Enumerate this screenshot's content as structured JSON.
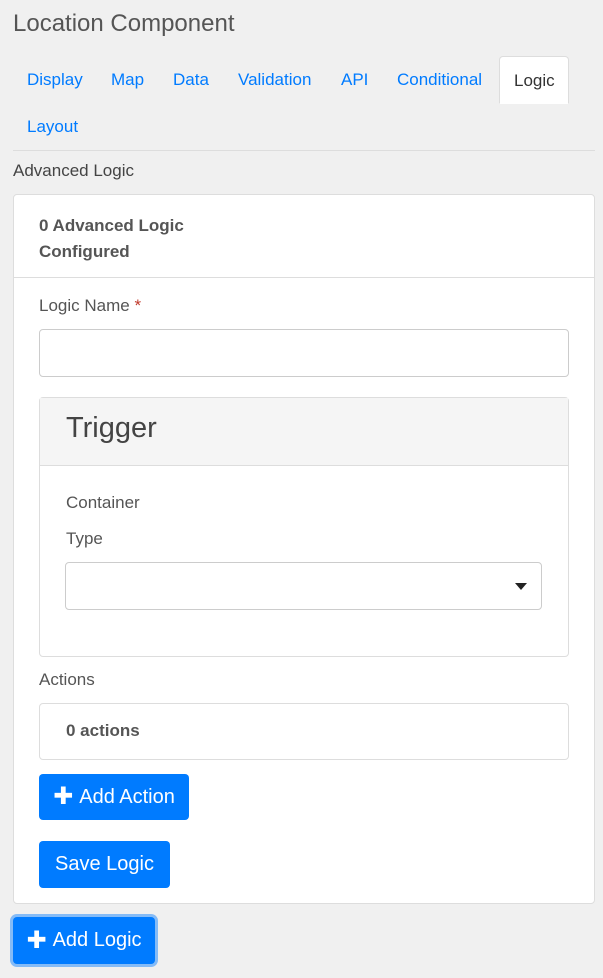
{
  "title": "Location Component",
  "tabs": [
    {
      "label": "Display"
    },
    {
      "label": "Map"
    },
    {
      "label": "Data"
    },
    {
      "label": "Validation"
    },
    {
      "label": "API"
    },
    {
      "label": "Conditional"
    },
    {
      "label": "Logic"
    },
    {
      "label": "Layout"
    }
  ],
  "active_tab": "Logic",
  "section_label": "Advanced Logic",
  "card": {
    "header_line1": "0 Advanced Logic",
    "header_line2": "Configured",
    "logic_name_label": "Logic Name",
    "required_mark": "*",
    "logic_name_value": ""
  },
  "trigger": {
    "title": "Trigger",
    "container_label": "Container",
    "type_label": "Type",
    "type_value": ""
  },
  "actions": {
    "label": "Actions",
    "count_text": "0 actions",
    "add_action_label": "Add Action"
  },
  "save_logic_label": "Save Logic",
  "add_logic_label": "Add Logic",
  "icons": {
    "plus": "plus-icon",
    "dropdown": "caret-down-icon"
  },
  "colors": {
    "primary": "#007bff",
    "required": "#c0392b"
  }
}
